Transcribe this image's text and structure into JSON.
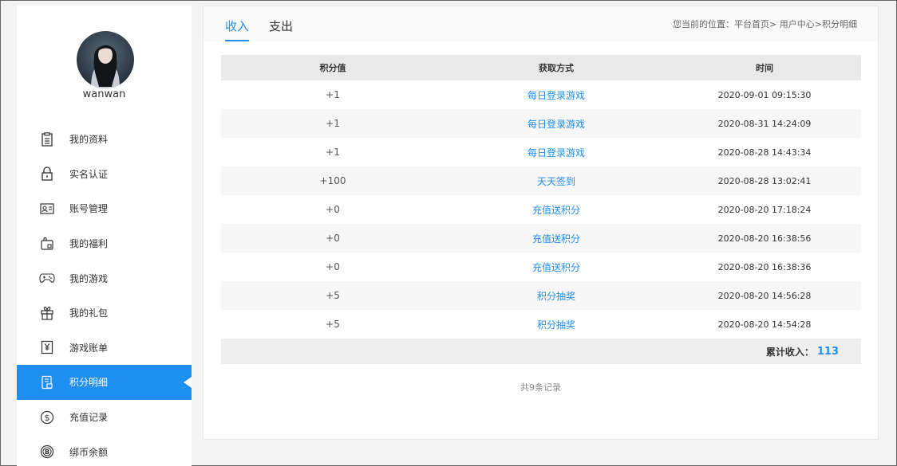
{
  "user": {
    "name": "wanwan"
  },
  "sidebar": {
    "items": [
      {
        "label": "我的资料",
        "icon": "clipboard-icon"
      },
      {
        "label": "实名认证",
        "icon": "lock-icon"
      },
      {
        "label": "账号管理",
        "icon": "id-card-icon"
      },
      {
        "label": "我的福利",
        "icon": "bag-icon"
      },
      {
        "label": "我的游戏",
        "icon": "gamepad-icon"
      },
      {
        "label": "我的礼包",
        "icon": "gift-icon"
      },
      {
        "label": "游戏账单",
        "icon": "bill-icon"
      },
      {
        "label": "积分明细",
        "icon": "points-icon"
      },
      {
        "label": "充值记录",
        "icon": "dollar-icon"
      },
      {
        "label": "绑币余额",
        "icon": "coin-icon"
      }
    ],
    "active": "积分明细"
  },
  "tabs": [
    {
      "label": "收入"
    },
    {
      "label": "支出"
    }
  ],
  "breadcrumb": "您当前的位置：平台首页> 用户中心>积分明细",
  "table": {
    "headers": [
      "积分值",
      "获取方式",
      "时间"
    ],
    "rows": [
      {
        "points": "+1",
        "method": "每日登录游戏",
        "time": "2020-09-01 09:15:30"
      },
      {
        "points": "+1",
        "method": "每日登录游戏",
        "time": "2020-08-31 14:24:09"
      },
      {
        "points": "+1",
        "method": "每日登录游戏",
        "time": "2020-08-28 14:43:34"
      },
      {
        "points": "+100",
        "method": "天天签到",
        "time": "2020-08-28 13:02:41"
      },
      {
        "points": "+0",
        "method": "充值送积分",
        "time": "2020-08-20 17:18:24"
      },
      {
        "points": "+0",
        "method": "充值送积分",
        "time": "2020-08-20 16:38:56"
      },
      {
        "points": "+0",
        "method": "充值送积分",
        "time": "2020-08-20 16:38:36"
      },
      {
        "points": "+5",
        "method": "积分抽奖",
        "time": "2020-08-20 14:56:28"
      },
      {
        "points": "+5",
        "method": "积分抽奖",
        "time": "2020-08-20 14:54:28"
      }
    ],
    "total_label": "累计收入：",
    "total_value": "113"
  },
  "record_count": "共9条记录",
  "colors": {
    "accent": "#1f8ef1"
  }
}
